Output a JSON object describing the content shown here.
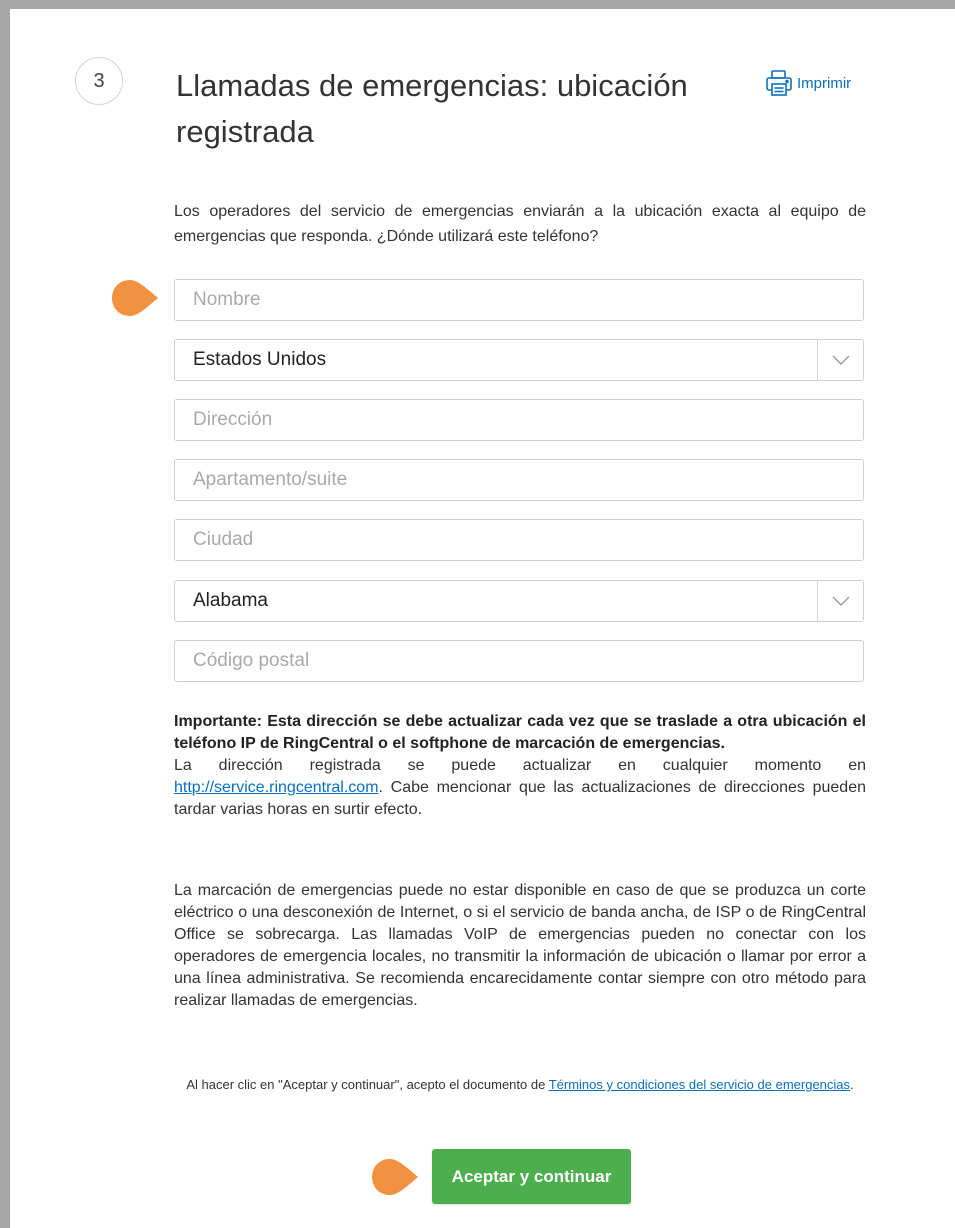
{
  "step": {
    "number": "3"
  },
  "header": {
    "title": "Llamadas de emergencias: ubicación registrada",
    "print_label": "Imprimir"
  },
  "description": "Los operadores del servicio de emergencias enviarán a la ubicación exacta al equipo de emergencias que responda. ¿Dónde utilizará este teléfono?",
  "form": {
    "name_placeholder": "Nombre",
    "country_value": "Estados Unidos",
    "address_placeholder": "Dirección",
    "apartment_placeholder": "Apartamento/suite",
    "city_placeholder": "Ciudad",
    "state_value": "Alabama",
    "zip_placeholder": "Código postal"
  },
  "important": {
    "bold_text": "Importante: Esta dirección se debe actualizar cada vez que se traslade a otra ubicación el teléfono IP de RingCentral o el softphone de marcación de emergencias.",
    "update_text_before": "La dirección registrada se puede actualizar en cualquier momento en ",
    "service_link": "http://service.ringcentral.com",
    "update_text_after": ". Cabe mencionar que las actualizaciones de direcciones pueden tardar varias horas en surtir efecto."
  },
  "disclaimer": "La marcación de emergencias puede no estar disponible en caso de que se produzca un corte eléctrico o una desconexión de Internet, o si el servicio de banda ancha, de ISP o de RingCentral Office se sobrecarga. Las llamadas VoIP de emergencias pueden no conectar con los operadores de emergencia locales, no transmitir la información de ubicación o llamar por error a una línea administrativa. Se recomienda encarecidamente contar siempre con otro método para realizar llamadas de emergencias.",
  "terms": {
    "text_before": "Al hacer clic en \"Aceptar y continuar\", acepto el documento de ",
    "link": "Términos y condiciones del servicio de emergencias",
    "text_after": "."
  },
  "accept_button": "Aceptar y continuar",
  "colors": {
    "accent_link": "#0b6fc1",
    "button_green": "#4cae4c",
    "pointer_orange": "#f2913f"
  }
}
